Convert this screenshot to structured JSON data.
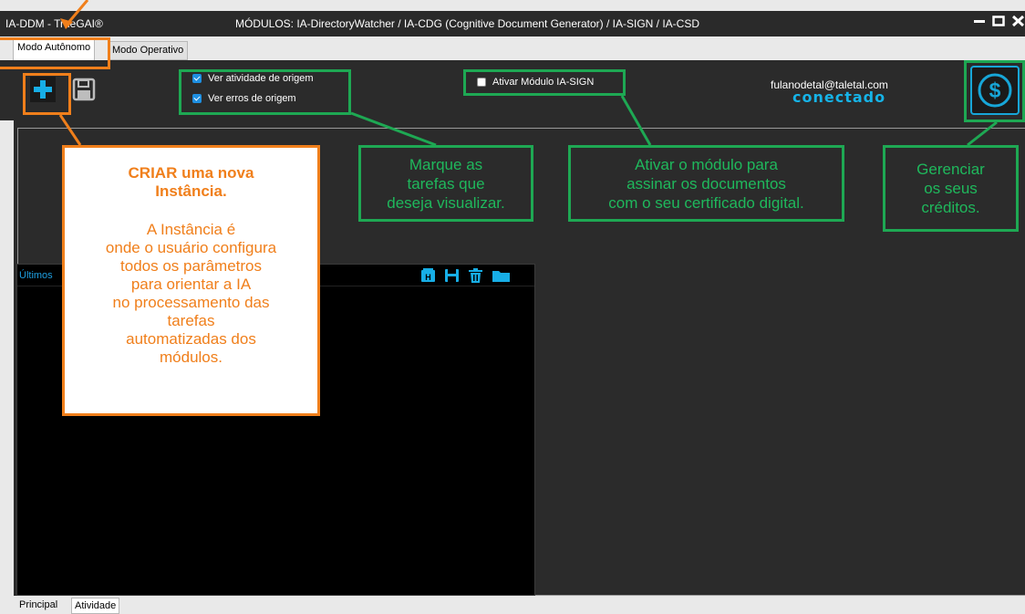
{
  "window": {
    "app_title": "IA-DDM  -  TrueGAI®",
    "modules_title": "MÓDULOS:  IA-DirectoryWatcher / IA-CDG (Cognitive Document Generator) / IA-SIGN / IA-CSD"
  },
  "tabs": [
    {
      "label": "Modo Autônomo",
      "active": true
    },
    {
      "label": "Modo Operativo",
      "active": false
    }
  ],
  "toolbar": {
    "add_icon": "plus-icon",
    "save_icon": "save-icon",
    "checkboxes": [
      {
        "label": "Ver atividade de origem",
        "checked": true
      },
      {
        "label": "Ver erros de origem",
        "checked": true
      }
    ],
    "sign_module": {
      "label": "Ativar Módulo IA-SIGN",
      "checked": false
    },
    "user_email": "fulanodetal@taletal.com",
    "connection_status": "conectado",
    "credits_icon": "dollar-icon"
  },
  "log_panel": {
    "title": "Últimos",
    "icons": [
      "history-icon",
      "save-icon",
      "trash-icon",
      "folder-icon"
    ]
  },
  "bottom_tabs": [
    {
      "label": "Principal"
    },
    {
      "label": "Atividade"
    }
  ],
  "annotations": {
    "create_heading": "CRIAR uma nova Instância.",
    "create_body_lines": [
      "A Instância é",
      "onde o usuário configura",
      "todos os parâmetros",
      "para orientar a IA",
      "no processamento das",
      "tarefas",
      "automatizadas dos",
      "módulos."
    ],
    "tasks_lines": [
      "Marque as",
      "tarefas que",
      "deseja visualizar."
    ],
    "sign_lines": [
      "Ativar o módulo para",
      "assinar os documentos",
      "com o seu certificado digital."
    ],
    "credits_lines": [
      "Gerenciar",
      "os seus",
      "créditos."
    ]
  },
  "colors": {
    "annotation_green": "#1ea853",
    "annotation_orange": "#f07f1b",
    "accent_blue": "#16b4e8"
  }
}
